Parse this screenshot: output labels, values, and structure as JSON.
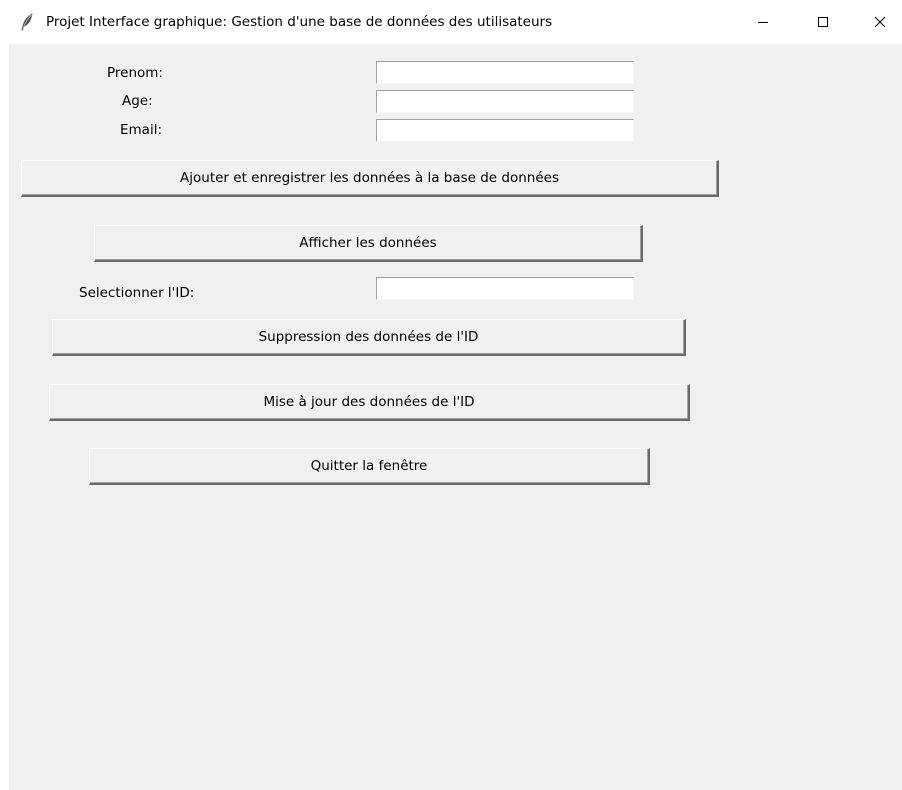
{
  "window": {
    "title": "Projet Interface graphique: Gestion d'une base de données des utilisateurs",
    "icon": "feather-icon",
    "controls": [
      "minimize-icon",
      "maximize-icon",
      "close-icon"
    ]
  },
  "form": {
    "prenom_label": "Prenom:",
    "prenom_value": "",
    "age_label": "Age:",
    "age_value": "",
    "email_label": "Email:",
    "email_value": "",
    "select_id_label": "Selectionner l'ID:",
    "select_id_value": ""
  },
  "buttons": {
    "add": "Ajouter et enregistrer les données à la base de données",
    "show": "Afficher les données",
    "delete": "Suppression des données de l'ID",
    "update": "Mise à jour des données de l'ID",
    "quit": "Quitter la fenêtre"
  },
  "colors": {
    "background": "#f0f0f0",
    "titlebar": "#ffffff",
    "entry": "#ffffff"
  }
}
